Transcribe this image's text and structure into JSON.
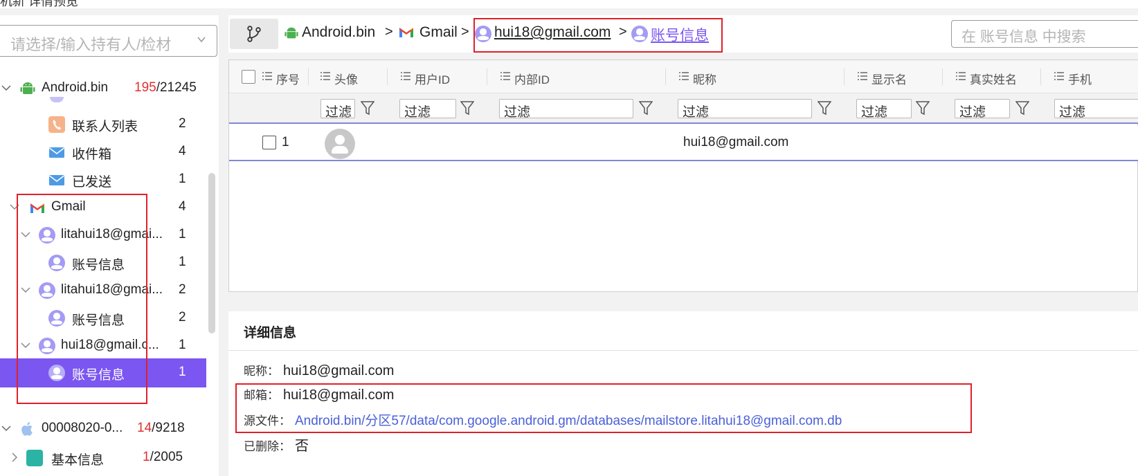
{
  "top_strip": {
    "text": "机新  详情预览"
  },
  "sidebar": {
    "owner_placeholder": "请选择/输入持有人/检材",
    "root": {
      "label": "Android.bin",
      "count_red": "195",
      "count_total": "/21245"
    },
    "items": [
      {
        "label": "联系人列表",
        "count": "2"
      },
      {
        "label": "收件箱",
        "count": "4"
      },
      {
        "label": "已发送",
        "count": "1"
      },
      {
        "label": "Gmail",
        "count": "4"
      },
      {
        "label": "litahui18@gmai...",
        "count": "1"
      },
      {
        "label": "账号信息",
        "count": "1"
      },
      {
        "label": "litahui18@gmai...",
        "count": "2"
      },
      {
        "label": "账号信息",
        "count": "2"
      },
      {
        "label": "hui18@gmail.c...",
        "count": "1"
      },
      {
        "label": "账号信息",
        "count": "1"
      }
    ],
    "root2": {
      "label": "00008020-0...",
      "count_red": "14",
      "count_total": "/9218"
    },
    "root2_child": {
      "label": "基本信息",
      "count_red": "1",
      "count_total": "/2005"
    }
  },
  "breadcrumb": {
    "items": [
      "Android.bin",
      "Gmail",
      "hui18@gmail.com",
      "账号信息"
    ],
    "separator": ">"
  },
  "search": {
    "placeholder": "在 账号信息 中搜索"
  },
  "table": {
    "columns": [
      "序号",
      "头像",
      "用户ID",
      "内部ID",
      "昵称",
      "显示名",
      "真实姓名",
      "手机"
    ],
    "filter_placeholder": "过滤",
    "rows": [
      {
        "index": "1",
        "nickname": "hui18@gmail.com"
      }
    ]
  },
  "detail": {
    "title": "详细信息",
    "fields": [
      {
        "key": "昵称：",
        "value": "hui18@gmail.com"
      },
      {
        "key": "邮箱：",
        "value": "hui18@gmail.com"
      },
      {
        "key": "源文件：",
        "value": "Android.bin/分区57/data/com.google.android.gm/databases/mailstore.litahui18@gmail.com.db"
      },
      {
        "key": "已删除：",
        "value": "否"
      }
    ]
  },
  "colors": {
    "accent": "#7b56f0",
    "highlight_box": "#e0202a",
    "link": "#4a5fd8",
    "count_red": "#e0302f"
  }
}
